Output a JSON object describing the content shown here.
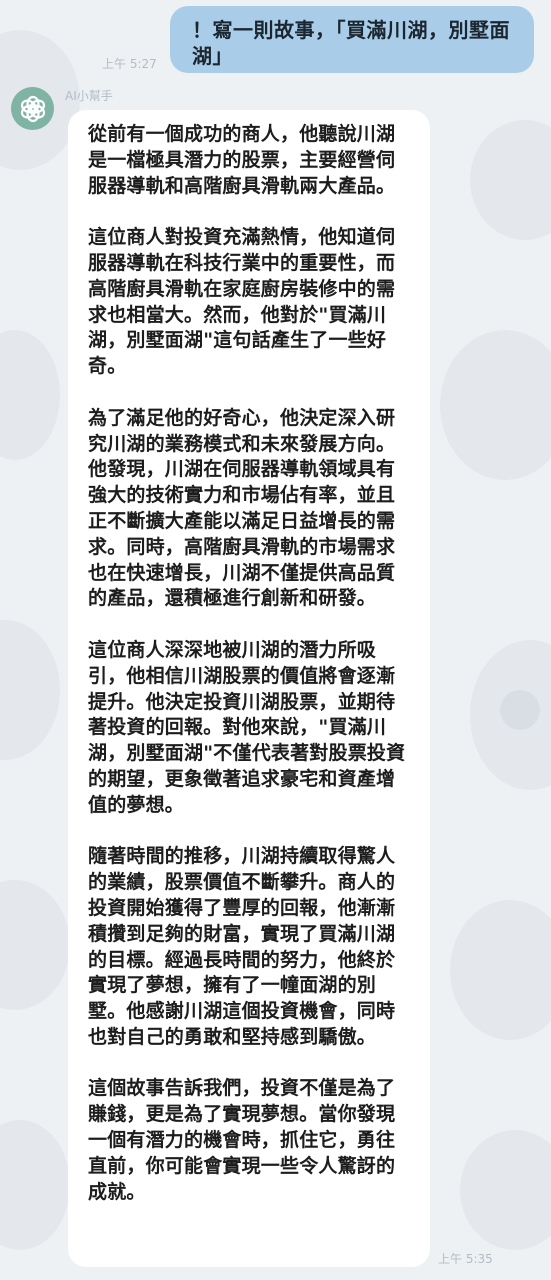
{
  "user_message": {
    "text": "！寫一則故事，「買滿川湖，別墅面湖」",
    "time": "上午 5:27"
  },
  "bot": {
    "name": "AI小幫手",
    "avatar_icon": "openai-logo-icon",
    "avatar_color": "#7fb3a3",
    "time": "上午 5:35",
    "text": "從前有一個成功的商人，他聽說川湖是一檔極具潛力的股票，主要經營伺服器導軌和高階廚具滑軌兩大產品。\n\n這位商人對投資充滿熱情，他知道伺服器導軌在科技行業中的重要性，而高階廚具滑軌在家庭廚房裝修中的需求也相當大。然而，他對於\"買滿川湖，別墅面湖\"這句話產生了一些好奇。\n\n為了滿足他的好奇心，他決定深入研究川湖的業務模式和未來發展方向。他發現，川湖在伺服器導軌領域具有強大的技術實力和市場佔有率，並且正不斷擴大產能以滿足日益增長的需求。同時，高階廚具滑軌的市場需求也在快速增長，川湖不僅提供高品質的產品，還積極進行創新和研發。\n\n這位商人深深地被川湖的潛力所吸引，他相信川湖股票的價值將會逐漸提升。他決定投資川湖股票，並期待著投資的回報。對他來說，\"買滿川湖，別墅面湖\"不僅代表著對股票投資的期望，更象徵著追求豪宅和資產增值的夢想。\n\n隨著時間的推移，川湖持續取得驚人的業績，股票價值不斷攀升。商人的投資開始獲得了豐厚的回報，他漸漸積攢到足夠的財富，實現了買滿川湖的目標。經過長時間的努力，他終於實現了夢想，擁有了一幢面湖的別墅。他感謝川湖這個投資機會，同時也對自己的勇敢和堅持感到驕傲。\n\n這個故事告訴我們，投資不僅是為了賺錢，更是為了實現夢想。當你發現一個有潛力的機會時，抓住它，勇往直前，你可能會實現一些令人驚訝的成就。"
  },
  "colors": {
    "user_bubble": "#a9cde8",
    "bot_bubble": "#ffffff",
    "background": "#eef1f4"
  }
}
